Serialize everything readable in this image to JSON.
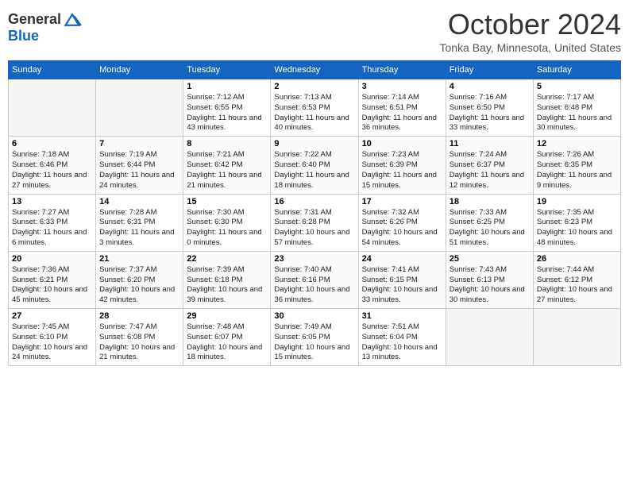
{
  "header": {
    "logo_general": "General",
    "logo_blue": "Blue",
    "month": "October 2024",
    "location": "Tonka Bay, Minnesota, United States"
  },
  "days_of_week": [
    "Sunday",
    "Monday",
    "Tuesday",
    "Wednesday",
    "Thursday",
    "Friday",
    "Saturday"
  ],
  "weeks": [
    [
      {
        "day": "",
        "empty": true
      },
      {
        "day": "",
        "empty": true
      },
      {
        "day": "1",
        "sunrise": "Sunrise: 7:12 AM",
        "sunset": "Sunset: 6:55 PM",
        "daylight": "Daylight: 11 hours and 43 minutes."
      },
      {
        "day": "2",
        "sunrise": "Sunrise: 7:13 AM",
        "sunset": "Sunset: 6:53 PM",
        "daylight": "Daylight: 11 hours and 40 minutes."
      },
      {
        "day": "3",
        "sunrise": "Sunrise: 7:14 AM",
        "sunset": "Sunset: 6:51 PM",
        "daylight": "Daylight: 11 hours and 36 minutes."
      },
      {
        "day": "4",
        "sunrise": "Sunrise: 7:16 AM",
        "sunset": "Sunset: 6:50 PM",
        "daylight": "Daylight: 11 hours and 33 minutes."
      },
      {
        "day": "5",
        "sunrise": "Sunrise: 7:17 AM",
        "sunset": "Sunset: 6:48 PM",
        "daylight": "Daylight: 11 hours and 30 minutes."
      }
    ],
    [
      {
        "day": "6",
        "sunrise": "Sunrise: 7:18 AM",
        "sunset": "Sunset: 6:46 PM",
        "daylight": "Daylight: 11 hours and 27 minutes."
      },
      {
        "day": "7",
        "sunrise": "Sunrise: 7:19 AM",
        "sunset": "Sunset: 6:44 PM",
        "daylight": "Daylight: 11 hours and 24 minutes."
      },
      {
        "day": "8",
        "sunrise": "Sunrise: 7:21 AM",
        "sunset": "Sunset: 6:42 PM",
        "daylight": "Daylight: 11 hours and 21 minutes."
      },
      {
        "day": "9",
        "sunrise": "Sunrise: 7:22 AM",
        "sunset": "Sunset: 6:40 PM",
        "daylight": "Daylight: 11 hours and 18 minutes."
      },
      {
        "day": "10",
        "sunrise": "Sunrise: 7:23 AM",
        "sunset": "Sunset: 6:39 PM",
        "daylight": "Daylight: 11 hours and 15 minutes."
      },
      {
        "day": "11",
        "sunrise": "Sunrise: 7:24 AM",
        "sunset": "Sunset: 6:37 PM",
        "daylight": "Daylight: 11 hours and 12 minutes."
      },
      {
        "day": "12",
        "sunrise": "Sunrise: 7:26 AM",
        "sunset": "Sunset: 6:35 PM",
        "daylight": "Daylight: 11 hours and 9 minutes."
      }
    ],
    [
      {
        "day": "13",
        "sunrise": "Sunrise: 7:27 AM",
        "sunset": "Sunset: 6:33 PM",
        "daylight": "Daylight: 11 hours and 6 minutes."
      },
      {
        "day": "14",
        "sunrise": "Sunrise: 7:28 AM",
        "sunset": "Sunset: 6:31 PM",
        "daylight": "Daylight: 11 hours and 3 minutes."
      },
      {
        "day": "15",
        "sunrise": "Sunrise: 7:30 AM",
        "sunset": "Sunset: 6:30 PM",
        "daylight": "Daylight: 11 hours and 0 minutes."
      },
      {
        "day": "16",
        "sunrise": "Sunrise: 7:31 AM",
        "sunset": "Sunset: 6:28 PM",
        "daylight": "Daylight: 10 hours and 57 minutes."
      },
      {
        "day": "17",
        "sunrise": "Sunrise: 7:32 AM",
        "sunset": "Sunset: 6:26 PM",
        "daylight": "Daylight: 10 hours and 54 minutes."
      },
      {
        "day": "18",
        "sunrise": "Sunrise: 7:33 AM",
        "sunset": "Sunset: 6:25 PM",
        "daylight": "Daylight: 10 hours and 51 minutes."
      },
      {
        "day": "19",
        "sunrise": "Sunrise: 7:35 AM",
        "sunset": "Sunset: 6:23 PM",
        "daylight": "Daylight: 10 hours and 48 minutes."
      }
    ],
    [
      {
        "day": "20",
        "sunrise": "Sunrise: 7:36 AM",
        "sunset": "Sunset: 6:21 PM",
        "daylight": "Daylight: 10 hours and 45 minutes."
      },
      {
        "day": "21",
        "sunrise": "Sunrise: 7:37 AM",
        "sunset": "Sunset: 6:20 PM",
        "daylight": "Daylight: 10 hours and 42 minutes."
      },
      {
        "day": "22",
        "sunrise": "Sunrise: 7:39 AM",
        "sunset": "Sunset: 6:18 PM",
        "daylight": "Daylight: 10 hours and 39 minutes."
      },
      {
        "day": "23",
        "sunrise": "Sunrise: 7:40 AM",
        "sunset": "Sunset: 6:16 PM",
        "daylight": "Daylight: 10 hours and 36 minutes."
      },
      {
        "day": "24",
        "sunrise": "Sunrise: 7:41 AM",
        "sunset": "Sunset: 6:15 PM",
        "daylight": "Daylight: 10 hours and 33 minutes."
      },
      {
        "day": "25",
        "sunrise": "Sunrise: 7:43 AM",
        "sunset": "Sunset: 6:13 PM",
        "daylight": "Daylight: 10 hours and 30 minutes."
      },
      {
        "day": "26",
        "sunrise": "Sunrise: 7:44 AM",
        "sunset": "Sunset: 6:12 PM",
        "daylight": "Daylight: 10 hours and 27 minutes."
      }
    ],
    [
      {
        "day": "27",
        "sunrise": "Sunrise: 7:45 AM",
        "sunset": "Sunset: 6:10 PM",
        "daylight": "Daylight: 10 hours and 24 minutes."
      },
      {
        "day": "28",
        "sunrise": "Sunrise: 7:47 AM",
        "sunset": "Sunset: 6:08 PM",
        "daylight": "Daylight: 10 hours and 21 minutes."
      },
      {
        "day": "29",
        "sunrise": "Sunrise: 7:48 AM",
        "sunset": "Sunset: 6:07 PM",
        "daylight": "Daylight: 10 hours and 18 minutes."
      },
      {
        "day": "30",
        "sunrise": "Sunrise: 7:49 AM",
        "sunset": "Sunset: 6:05 PM",
        "daylight": "Daylight: 10 hours and 15 minutes."
      },
      {
        "day": "31",
        "sunrise": "Sunrise: 7:51 AM",
        "sunset": "Sunset: 6:04 PM",
        "daylight": "Daylight: 10 hours and 13 minutes."
      },
      {
        "day": "",
        "empty": true
      },
      {
        "day": "",
        "empty": true
      }
    ]
  ]
}
